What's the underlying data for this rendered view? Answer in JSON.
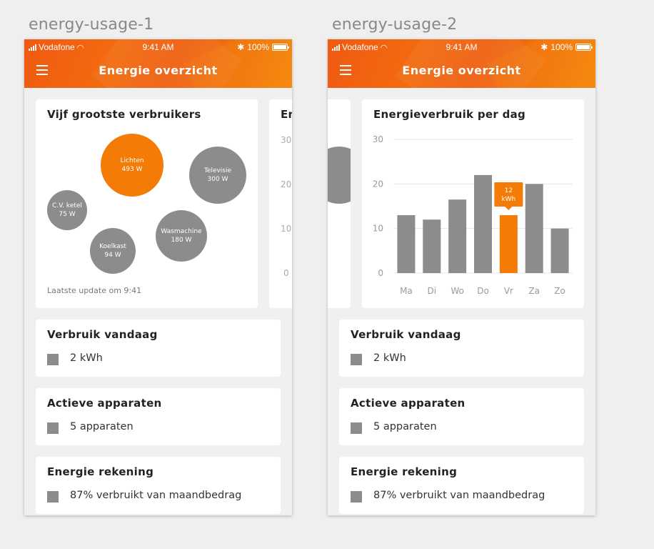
{
  "artboards": [
    "energy-usage-1",
    "energy-usage-2"
  ],
  "status_bar": {
    "carrier": "Vodafone",
    "time": "9:41 AM",
    "battery": "100%"
  },
  "header": {
    "title": "Energie overzicht"
  },
  "consumers_card": {
    "title": "Vijf grootste verbruikers",
    "update": "Laatste update om 9:41",
    "bubbles": [
      {
        "name": "Lichten",
        "value": "493 W",
        "highlight": true
      },
      {
        "name": "Televisie",
        "value": "300 W"
      },
      {
        "name": "C.V. ketel",
        "value": "75 W"
      },
      {
        "name": "Wasmachine",
        "value": "180 W"
      },
      {
        "name": "Koelkast",
        "value": "94 W"
      }
    ]
  },
  "peek_card": {
    "title_partial": "En",
    "ticks": [
      "30",
      "20",
      "10",
      "0"
    ]
  },
  "stats": [
    {
      "title": "Verbruik vandaag",
      "value": "2 kWh"
    },
    {
      "title": "Actieve apparaten",
      "value": "5 apparaten"
    },
    {
      "title": "Energie rekening",
      "value": "87% verbruikt van maandbedrag"
    }
  ],
  "chart_data": {
    "type": "bar",
    "title": "Energieverbruik per dag",
    "categories": [
      "Ma",
      "Di",
      "Wo",
      "Do",
      "Vr",
      "Za",
      "Zo"
    ],
    "values": [
      13,
      12,
      16.5,
      22,
      13,
      20,
      10
    ],
    "ylim": [
      0,
      30
    ],
    "yticks": [
      "30",
      "20",
      "10",
      "0"
    ],
    "highlight_index": 4,
    "tooltip": {
      "value": "12",
      "unit": "kWh"
    },
    "colors": {
      "bar": "#8c8c8c",
      "highlight": "#f37b06",
      "grid": "#e6e6e6"
    }
  },
  "colors": {
    "accent": "#f37b06",
    "header": "#f26b0f"
  }
}
